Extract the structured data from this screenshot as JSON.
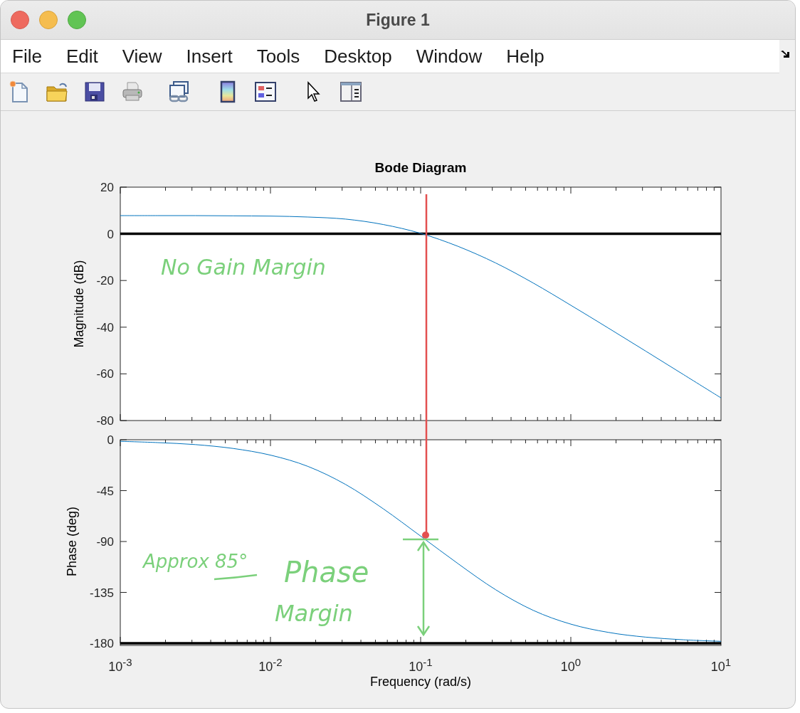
{
  "window": {
    "title": "Figure 1"
  },
  "menu": [
    "File",
    "Edit",
    "View",
    "Insert",
    "Tools",
    "Desktop",
    "Window",
    "Help"
  ],
  "magnitude_plot": {
    "chart_data": {
      "type": "line",
      "title": "Bode Diagram",
      "ylabel": "Magnitude (dB)",
      "categories": [
        null,
        null,
        null,
        null,
        null,
        null,
        null,
        null,
        null,
        null,
        null,
        null,
        null,
        null,
        null,
        null,
        null
      ],
      "series": [
        {
          "color": "#0072bd",
          "values": [
            7.8,
            7.8,
            7.8,
            7.7,
            7.6,
            7.2,
            6.3,
            4.0,
            0.2,
            -5.4,
            -12.5,
            -21.1,
            -30.6,
            -40.4,
            -50.3,
            -60.3,
            -70.3
          ]
        }
      ],
      "ylim": [
        -80,
        20
      ],
      "yticks": [
        20,
        0,
        -20,
        -40,
        -60,
        -80
      ],
      "ref_lines": [
        {
          "axis": "y",
          "value": 0
        }
      ]
    }
  },
  "phase_plot": {
    "chart_data": {
      "type": "line",
      "xlabel": "Frequency  (rad/s)",
      "ylabel": "Phase (deg)",
      "categories": [
        "10$^{-3}$",
        null,
        null,
        null,
        "10$^{-2}$",
        null,
        null,
        null,
        "10$^{-1}$",
        null,
        null,
        null,
        "10$^{0}$",
        null,
        null,
        null,
        "10$^{1}$"
      ],
      "series": [
        {
          "color": "#0072bd",
          "values": [
            -1.4,
            -2.5,
            -4.3,
            -7.7,
            -13.6,
            -23.6,
            -39.5,
            -61.0,
            -85.2,
            -109.7,
            -132.7,
            -150.9,
            -163.1,
            -170.4,
            -174.6,
            -176.9,
            -178.3
          ]
        }
      ],
      "ylim": [
        -180,
        0
      ],
      "yticks": [
        0,
        -45,
        -90,
        -135,
        -180
      ],
      "ref_lines": [
        {
          "axis": "y",
          "value": -180
        }
      ]
    }
  },
  "handwritten_notes": [
    {
      "text": "No Gain Margin"
    },
    {
      "text": "Approx 85°"
    },
    {
      "text": "Phase"
    },
    {
      "text": "Margin"
    }
  ]
}
